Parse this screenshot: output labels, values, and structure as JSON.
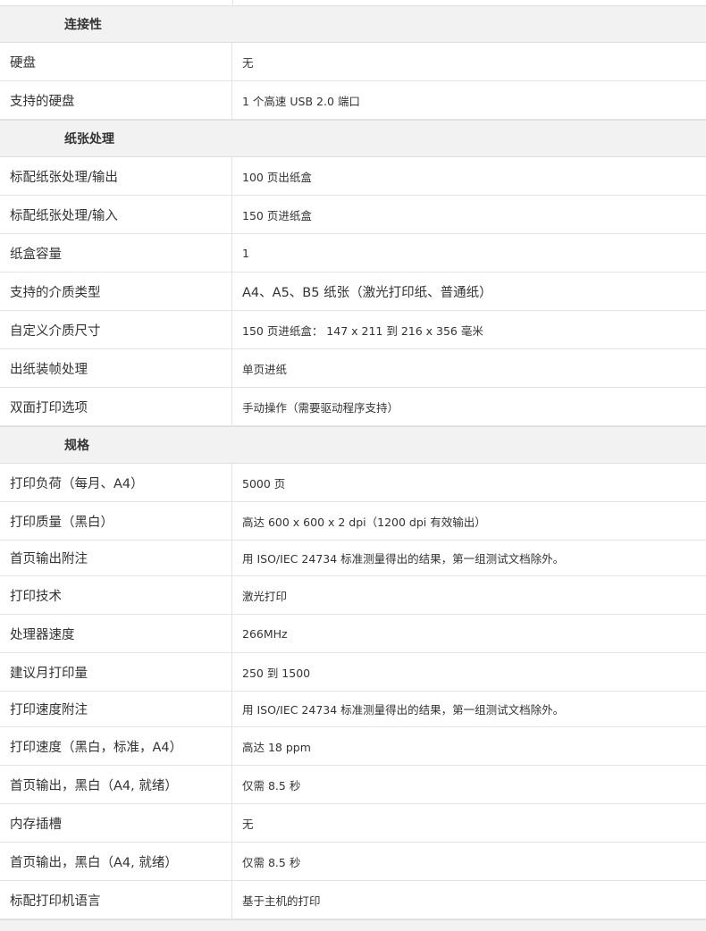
{
  "sections": [
    {
      "title": "连接性",
      "rows": [
        {
          "label": "硬盘",
          "value": "无"
        },
        {
          "label": "支持的硬盘",
          "value": "1 个高速 USB 2.0 端口"
        }
      ]
    },
    {
      "title": "纸张处理",
      "rows": [
        {
          "label": "标配纸张处理/输出",
          "value": "100 页出纸盒"
        },
        {
          "label": "标配纸张处理/输入",
          "value": "150 页进纸盒"
        },
        {
          "label": "纸盒容量",
          "value": "1"
        },
        {
          "label": "支持的介质类型",
          "value": "A4、A5、B5 纸张（激光打印纸、普通纸）"
        },
        {
          "label": "自定义介质尺寸",
          "value": "150 页进纸盒： 147 x 211 到 216 x 356 毫米"
        },
        {
          "label": "出纸装帧处理",
          "value": "单页进纸"
        },
        {
          "label": "双面打印选项",
          "value": "手动操作（需要驱动程序支持）"
        }
      ]
    },
    {
      "title": "规格",
      "rows": [
        {
          "label": "打印负荷（每月、A4）",
          "value": "5000 页"
        },
        {
          "label": "打印质量（黑白）",
          "value": "高达 600 x 600 x 2 dpi（1200 dpi 有效输出）"
        },
        {
          "label": "首页输出附注",
          "value": "用 ISO/IEC 24734 标准测量得出的结果，第一组测试文档除外。"
        },
        {
          "label": "打印技术",
          "value": "激光打印"
        },
        {
          "label": "处理器速度",
          "value": "266MHz"
        },
        {
          "label": "建议月打印量",
          "value": "250 到 1500"
        },
        {
          "label": "打印速度附注",
          "value": "用 ISO/IEC 24734 标准测量得出的结果，第一组测试文档除外。"
        },
        {
          "label": "打印速度（黑白，标准，A4）",
          "value": "高达 18 ppm"
        },
        {
          "label": "首页输出，黑白（A4, 就绪）",
          "value": "仅需 8.5 秒"
        },
        {
          "label": "内存插槽",
          "value": "无"
        },
        {
          "label": "首页输出，黑白（A4, 就绪）",
          "value": "仅需 8.5 秒"
        },
        {
          "label": "标配打印机语言",
          "value": "基于主机的打印"
        }
      ]
    }
  ]
}
